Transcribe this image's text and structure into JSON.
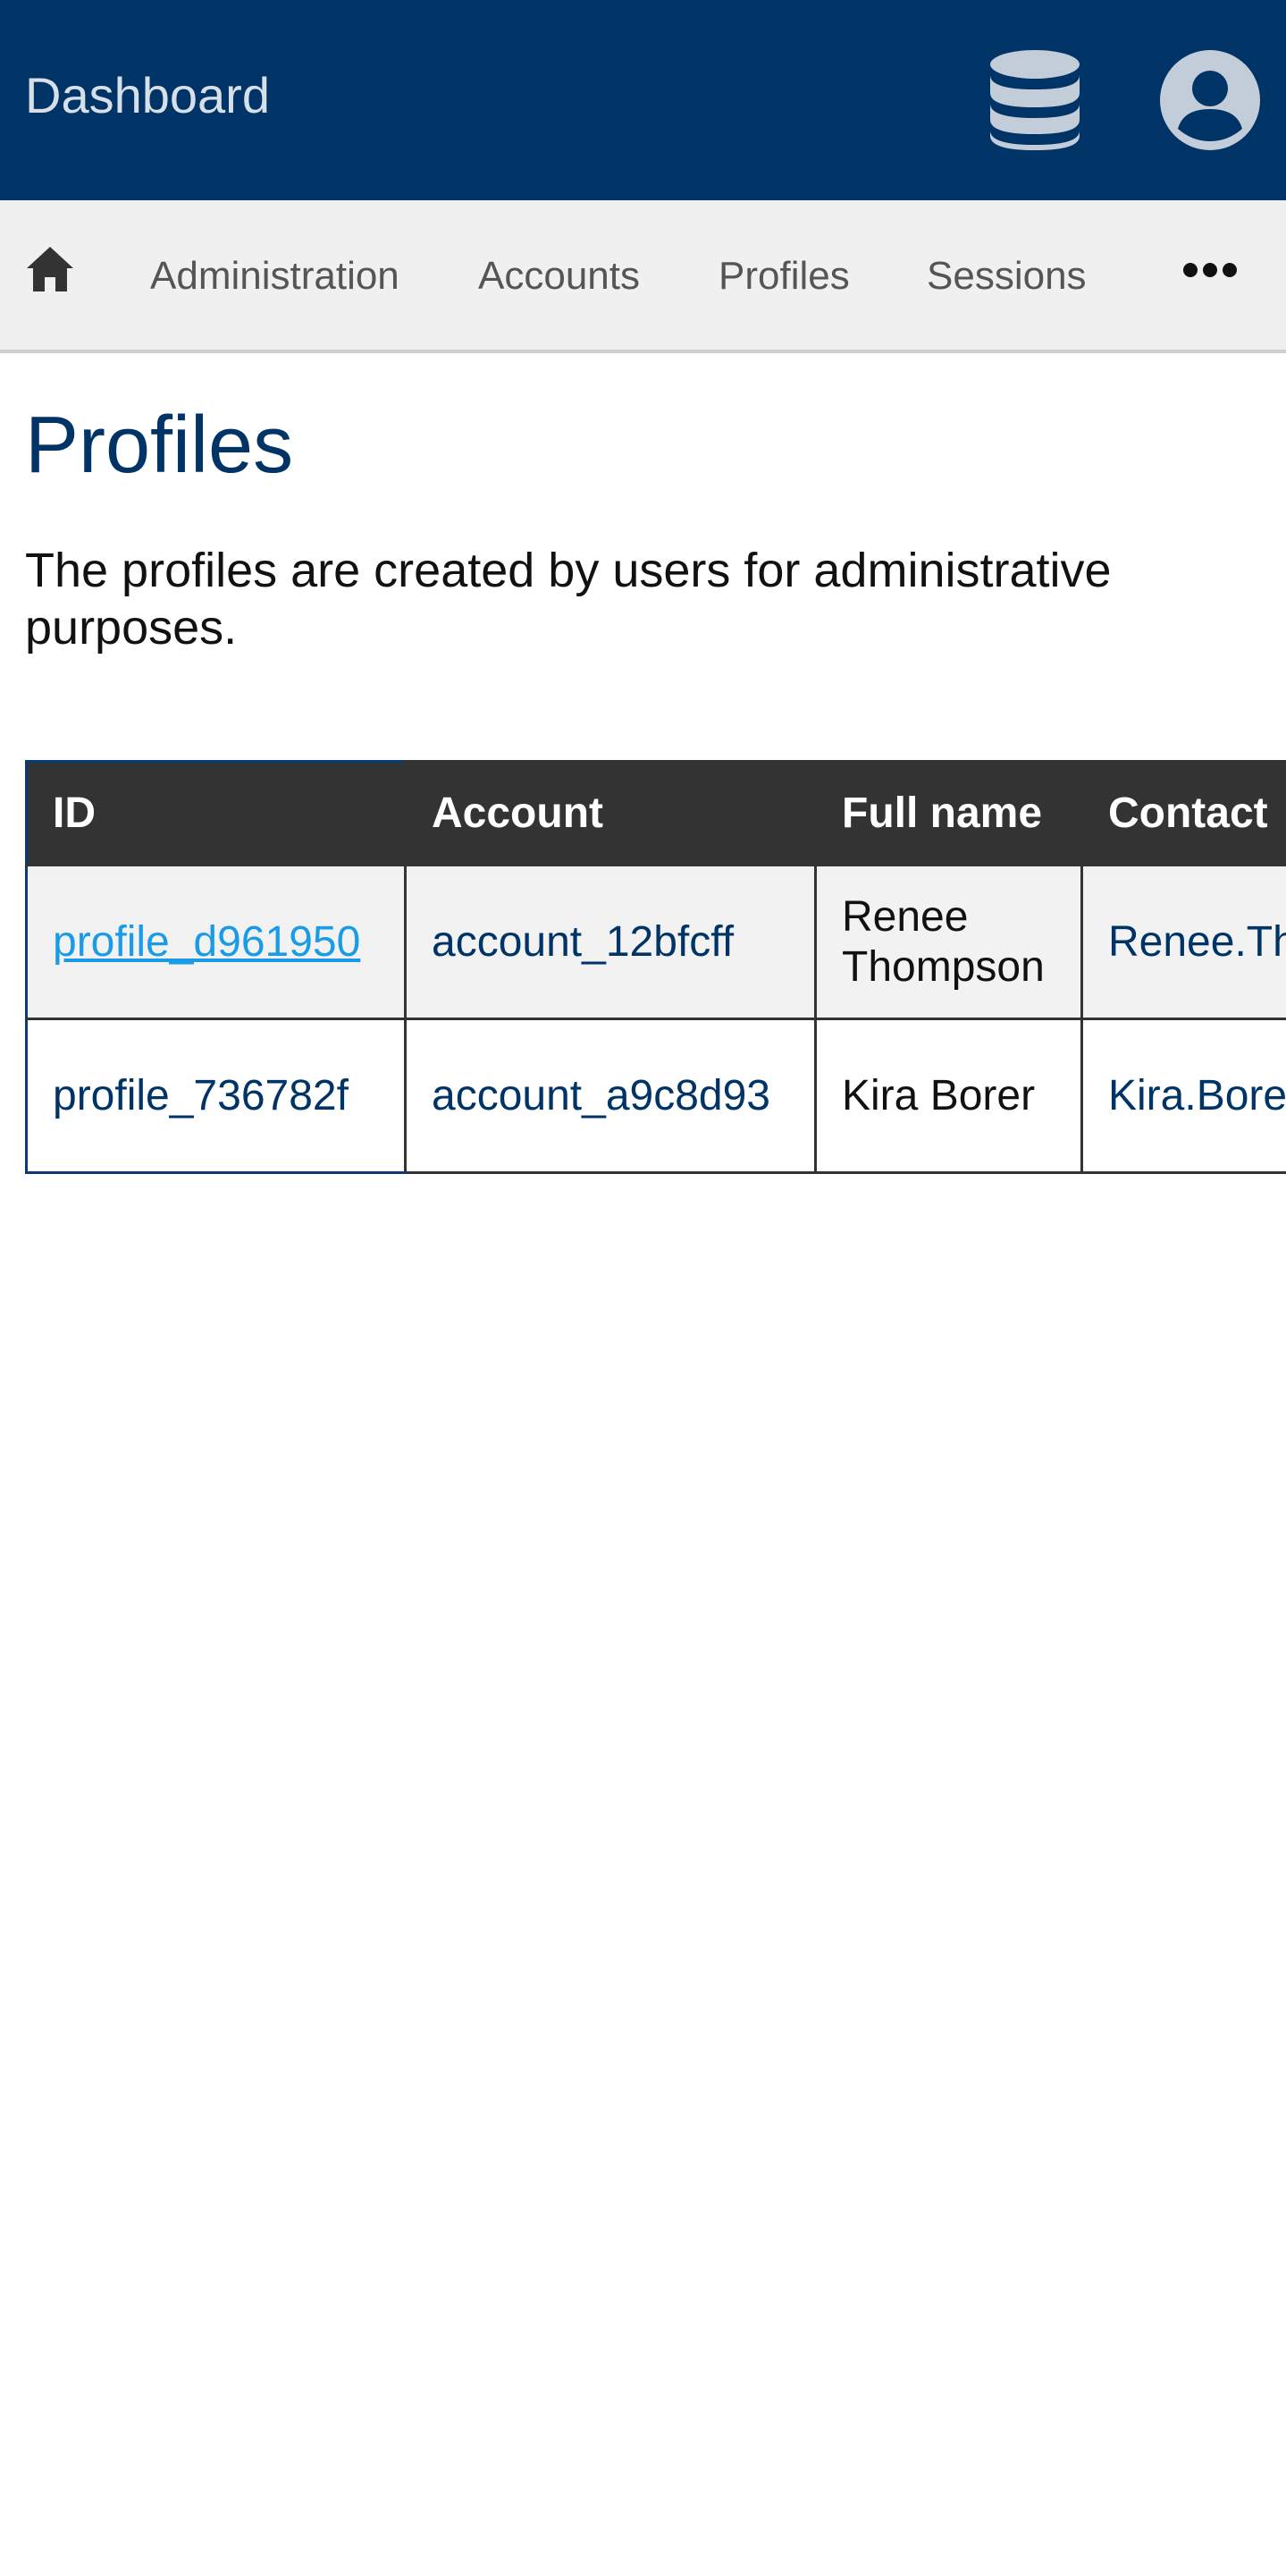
{
  "header": {
    "brand": "Dashboard",
    "database_icon": "database-icon",
    "user_icon": "user-circle-icon",
    "background_color": "#003366"
  },
  "nav": {
    "home_icon": "home-icon",
    "items": [
      {
        "label": "Administration"
      },
      {
        "label": "Accounts"
      },
      {
        "label": "Profiles"
      },
      {
        "label": "Sessions"
      }
    ],
    "more_icon": "more-horizontal-icon"
  },
  "page": {
    "title": "Profiles",
    "description": "The profiles are created by users for administrative purposes."
  },
  "table": {
    "columns": [
      "ID",
      "Account",
      "Full name",
      "Contact"
    ],
    "rows": [
      {
        "id": "profile_d961950",
        "account": "account_12bfcff",
        "full_name": "Renee Thompson",
        "contact": "Renee.Th"
      },
      {
        "id": "profile_736782f",
        "account": "account_a9c8d93",
        "full_name": "Kira Borer",
        "contact": "Kira.Bore"
      }
    ]
  }
}
